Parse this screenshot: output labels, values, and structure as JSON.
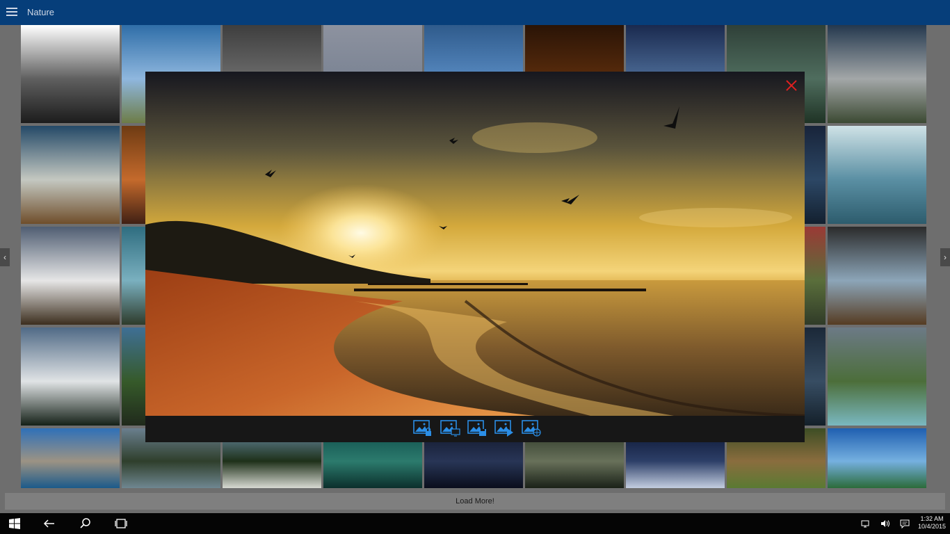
{
  "header": {
    "title": "Nature"
  },
  "gallery": {
    "tiles": [
      {
        "r": 0,
        "c": 0,
        "colors": [
          "#ffffff",
          "#5f5f5f",
          "#1c1c1c"
        ]
      },
      {
        "r": 0,
        "c": 1,
        "colors": [
          "#2f6ea8",
          "#8fb7de",
          "#6d7c47"
        ]
      },
      {
        "r": 0,
        "c": 2,
        "colors": [
          "#3e3e3e",
          "#6b6b6b",
          "#232323"
        ]
      },
      {
        "r": 0,
        "c": 3,
        "colors": [
          "#8d929f",
          "#7b8494",
          "#6b7381"
        ]
      },
      {
        "r": 0,
        "c": 4,
        "colors": [
          "#2f5b8c",
          "#5688bf",
          "#b0b8c6"
        ]
      },
      {
        "r": 0,
        "c": 5,
        "colors": [
          "#2a1406",
          "#5a2c0c",
          "#180a03"
        ]
      },
      {
        "r": 0,
        "c": 6,
        "colors": [
          "#1a2a4f",
          "#4c6b96",
          "#2f5a28"
        ]
      },
      {
        "r": 0,
        "c": 7,
        "colors": [
          "#2f4038",
          "#4f6d5e",
          "#1f3325"
        ]
      },
      {
        "r": 0,
        "c": 8,
        "colors": [
          "#24384e",
          "#a3a7a8",
          "#3c4a33"
        ]
      },
      {
        "r": 1,
        "c": 0,
        "colors": [
          "#244967",
          "#c4c8c1",
          "#6f4e2b"
        ]
      },
      {
        "r": 1,
        "c": 1,
        "colors": [
          "#6e3b13",
          "#c46a2c",
          "#402014"
        ]
      },
      {
        "r": 1,
        "c": 7,
        "colors": [
          "#18243a",
          "#2c4765",
          "#13202f"
        ]
      },
      {
        "r": 1,
        "c": 8,
        "colors": [
          "#cfe2e6",
          "#5a8fa3",
          "#2d5c6d"
        ]
      },
      {
        "r": 2,
        "c": 0,
        "colors": [
          "#4f5d72",
          "#e6e6e6",
          "#3c2e1e"
        ]
      },
      {
        "r": 2,
        "c": 1,
        "colors": [
          "#2f6d80",
          "#7ab0bf",
          "#2e3b2b"
        ]
      },
      {
        "r": 2,
        "c": 7,
        "colors": [
          "#9a3a35",
          "#5a6e3b",
          "#303b28"
        ]
      },
      {
        "r": 2,
        "c": 8,
        "colors": [
          "#2b2b2b",
          "#8ca5b8",
          "#563c22"
        ]
      },
      {
        "r": 3,
        "c": 0,
        "colors": [
          "#506a86",
          "#e0e3e5",
          "#142017"
        ]
      },
      {
        "r": 3,
        "c": 1,
        "colors": [
          "#3f6f95",
          "#365a2a",
          "#202a1c"
        ]
      },
      {
        "r": 3,
        "c": 7,
        "colors": [
          "#1b2838",
          "#374d63",
          "#14202a"
        ]
      },
      {
        "r": 3,
        "c": 8,
        "colors": [
          "#6c7a86",
          "#4c6e3a",
          "#7ab8c0"
        ]
      },
      {
        "r": 4,
        "c": 0,
        "colors": [
          "#2f70b8",
          "#9c9384",
          "#1b5a8a"
        ]
      },
      {
        "r": 4,
        "c": 1,
        "colors": [
          "#6a7f8e",
          "#2f3f2c",
          "#6f8791"
        ]
      },
      {
        "r": 4,
        "c": 2,
        "colors": [
          "#6b8ea8",
          "#1e3019",
          "#d7d9d2"
        ]
      },
      {
        "r": 4,
        "c": 3,
        "colors": [
          "#0e4c4a",
          "#2c7b6d",
          "#0b2f2c"
        ]
      },
      {
        "r": 4,
        "c": 4,
        "colors": [
          "#111629",
          "#283556",
          "#0a0e1c"
        ]
      },
      {
        "r": 4,
        "c": 5,
        "colors": [
          "#2b3627",
          "#68715a",
          "#1a2118"
        ]
      },
      {
        "r": 4,
        "c": 6,
        "colors": [
          "#0a1430",
          "#2d3f68",
          "#c3cde0"
        ]
      },
      {
        "r": 4,
        "c": 7,
        "colors": [
          "#3d4d24",
          "#8a6d3e",
          "#5a7a33"
        ]
      },
      {
        "r": 4,
        "c": 8,
        "colors": [
          "#1f5fb0",
          "#75b0e0",
          "#2b6b3a"
        ]
      }
    ]
  },
  "navigation": {
    "prev_icon": "chevron-left-icon",
    "next_icon": "chevron-right-icon",
    "prev_glyph": "‹",
    "next_glyph": "›"
  },
  "load_more": {
    "label": "Load More!"
  },
  "viewer": {
    "image_subject": "sunset beach",
    "close_icon": "close-icon",
    "close_color": "#e02020",
    "toolbar_accent": "#2b8ee6",
    "tools": [
      {
        "name": "lock-screen-button",
        "icon": "image-lock-icon",
        "badge": "lock"
      },
      {
        "name": "set-background-button",
        "icon": "image-desktop-icon",
        "badge": "desktop"
      },
      {
        "name": "save-image-button",
        "icon": "image-save-icon",
        "badge": "save"
      },
      {
        "name": "slideshow-button",
        "icon": "image-play-icon",
        "badge": "play"
      },
      {
        "name": "share-image-button",
        "icon": "image-globe-icon",
        "badge": "globe"
      }
    ]
  },
  "taskbar": {
    "time": "1:32 AM",
    "date": "10/4/2015",
    "icons": [
      "windows-start-icon",
      "back-arrow-icon",
      "search-icon",
      "task-view-icon"
    ],
    "tray": [
      "network-icon",
      "volume-icon",
      "notification-icon"
    ]
  }
}
